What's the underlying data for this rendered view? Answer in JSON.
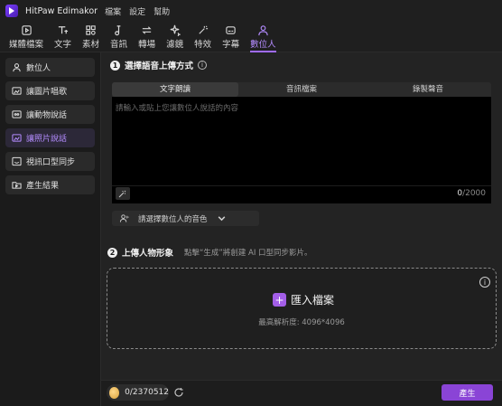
{
  "app": {
    "title": "HitPaw Edimakor"
  },
  "menu": [
    "檔案",
    "設定",
    "幫助"
  ],
  "toolbar": [
    {
      "label": "媒體檔案",
      "icon": "media-icon"
    },
    {
      "label": "文字",
      "icon": "text-icon"
    },
    {
      "label": "素材",
      "icon": "assets-icon"
    },
    {
      "label": "音訊",
      "icon": "audio-icon"
    },
    {
      "label": "轉場",
      "icon": "transition-icon"
    },
    {
      "label": "濾鏡",
      "icon": "filter-icon"
    },
    {
      "label": "特效",
      "icon": "effects-icon"
    },
    {
      "label": "字幕",
      "icon": "subtitle-icon"
    },
    {
      "label": "數位人",
      "icon": "digital-human-icon",
      "active": true
    }
  ],
  "sidebar": {
    "items": [
      {
        "label": "數位人",
        "icon": "person-icon"
      },
      {
        "label": "讓圖片唱歌",
        "icon": "image-sing-icon"
      },
      {
        "label": "讓動物說話",
        "icon": "animal-talk-icon"
      },
      {
        "label": "讓照片說話",
        "icon": "photo-talk-icon",
        "active": true
      },
      {
        "label": "視訊口型同步",
        "icon": "lip-sync-icon"
      },
      {
        "label": "產生結果",
        "icon": "folder-icon"
      }
    ]
  },
  "step1": {
    "number": "1",
    "title": "選擇語音上傳方式",
    "info": "i",
    "tabs": [
      "文字朗讀",
      "音訊檔案",
      "錄製聲音"
    ],
    "active_tab": 0,
    "textarea_placeholder": "請輸入或貼上您讓數位人說話的內容",
    "char_count": "0",
    "char_max": "/2000",
    "voice_select": "請選擇數位人的音色"
  },
  "step2": {
    "number": "2",
    "title": "上傳人物形象",
    "hint": "點擊“生成”將創建 AI 口型同步影片。",
    "import_label": "匯入檔案",
    "max_resolution": "最高解析度: 4096*4096",
    "info": "i"
  },
  "footer": {
    "credits": "0/2370512",
    "generate_label": "產生"
  },
  "colors": {
    "accent": "#8a44d6",
    "accent_text": "#b48cff",
    "background": "#1b1b1b"
  }
}
